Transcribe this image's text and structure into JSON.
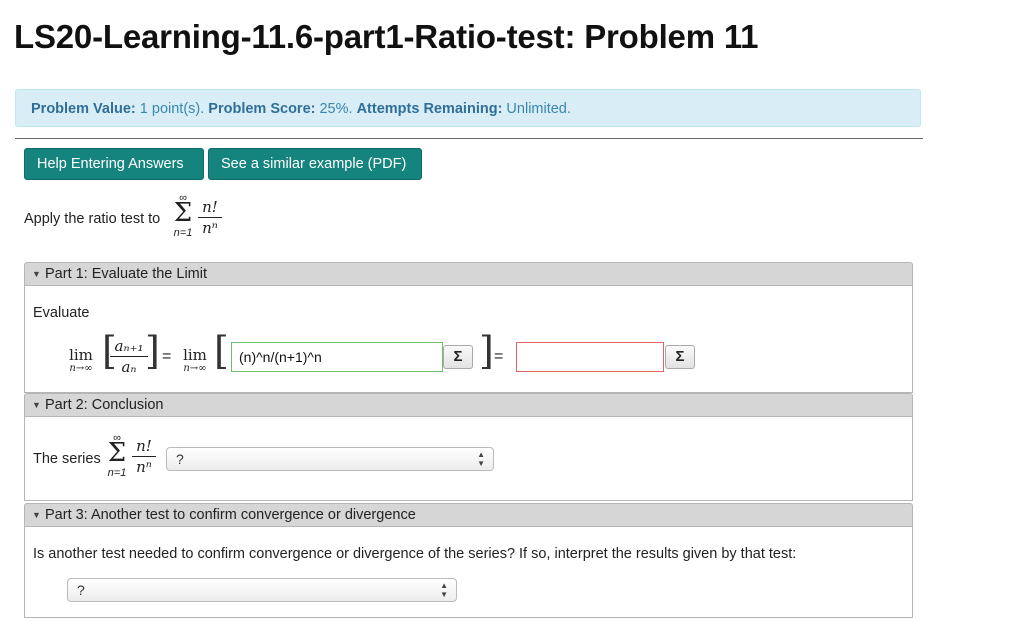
{
  "page": {
    "title": "LS20-Learning-11.6-part1-Ratio-test: Problem 11"
  },
  "info": {
    "value_label": "Problem Value:",
    "value_text": " 1 point(s). ",
    "score_label": "Problem Score:",
    "score_text": " 25%. ",
    "attempts_label": "Attempts Remaining:",
    "attempts_text": " Unlimited."
  },
  "buttons": {
    "help": "Help Entering Answers",
    "example": "See a similar example (PDF)"
  },
  "intro": {
    "text": "Apply the ratio test to",
    "sum_upper": "∞",
    "sum_symbol": "Σ",
    "sum_lower": "n=1",
    "numerator": "n!",
    "denominator": "nⁿ"
  },
  "part1": {
    "header": "Part 1: Evaluate the Limit",
    "evaluate_label": "Evaluate",
    "lim": "lim",
    "lim_sub": "n→∞",
    "frac_num": "aₙ₊₁",
    "frac_den": "aₙ",
    "equals": "=",
    "input_value": "(n)^n/(n+1)^n",
    "answer_value": "",
    "sigma_button": "Σ"
  },
  "part2": {
    "header": "Part 2: Conclusion",
    "series_label": "The series",
    "sum_upper": "∞",
    "sum_symbol": "Σ",
    "sum_lower": "n=1",
    "numerator": "n!",
    "denominator": "nⁿ",
    "select_value": "?"
  },
  "part3": {
    "header": "Part 3: Another test to confirm convergence or divergence",
    "question": "Is another test needed to confirm convergence or divergence of the series? If so, interpret the results given by that test:",
    "select_value": "?"
  }
}
